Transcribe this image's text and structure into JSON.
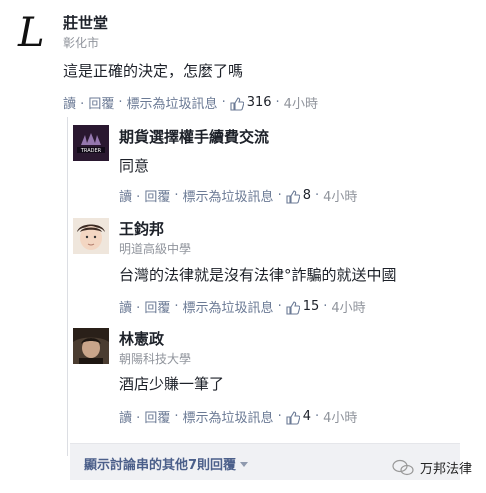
{
  "comments": [
    {
      "name": "莊世堂",
      "subtitle": "彰化市",
      "text": "這是正確的決定，怎麼了嗎",
      "actions": {
        "reply": "讀 · 回覆",
        "report": "標示為垃圾訊息",
        "likes": "316",
        "time": "4小時"
      }
    },
    {
      "name": "期貨選擇權手續費交流",
      "subtitle": "",
      "text": "同意",
      "avatar_caption": "TRADER",
      "actions": {
        "reply": "讀 · 回覆",
        "report": "標示為垃圾訊息",
        "likes": "8",
        "time": "4小時"
      }
    },
    {
      "name": "王鈞邦",
      "subtitle": "明道高級中學",
      "text": "台灣的法律就是沒有法律°詐騙的就送中國",
      "actions": {
        "reply": "讀 · 回覆",
        "report": "標示為垃圾訊息",
        "likes": "15",
        "time": "4小時"
      }
    },
    {
      "name": "林憲政",
      "subtitle": "朝陽科技大學",
      "text": "酒店少賺一筆了",
      "actions": {
        "reply": "讀 · 回覆",
        "report": "標示為垃圾訊息",
        "likes": "4",
        "time": "4小時"
      }
    }
  ],
  "more_replies": "顯示討論串的其他7則回覆",
  "watermark": "万邦法律",
  "colors": {
    "link": "#6b7a95",
    "more_bg": "#f0f1f4",
    "more_text": "#4b5f8a"
  }
}
